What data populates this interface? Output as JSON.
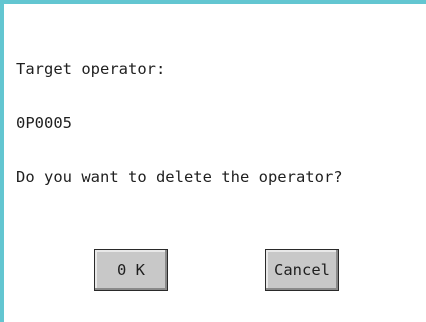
{
  "dialog": {
    "message_lines": [
      "Target operator:",
      "0P0005",
      "Do you want to delete the operator?"
    ],
    "ok_label": "0 K",
    "cancel_label": "Cancel"
  },
  "colors": {
    "frame_accent": "#63c6d1",
    "button_face": "#c8c8c8",
    "text": "#1f1f1f"
  }
}
